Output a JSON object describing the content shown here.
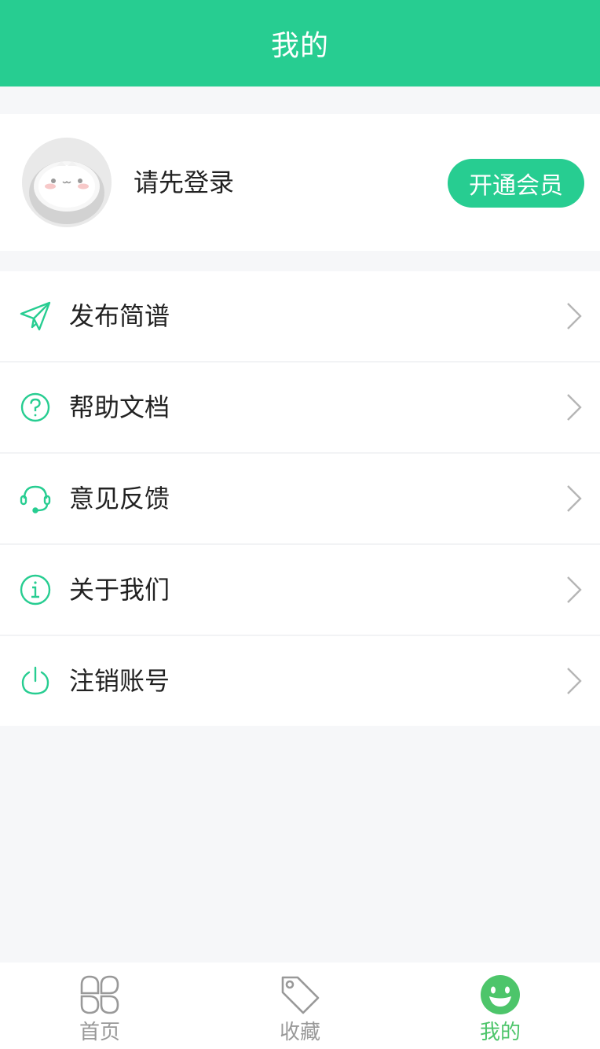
{
  "header": {
    "title": "我的"
  },
  "profile": {
    "login_prompt": "请先登录",
    "vip_button": "开通会员"
  },
  "menu": {
    "items": [
      {
        "label": "发布简谱",
        "icon": "paper-plane-icon"
      },
      {
        "label": "帮助文档",
        "icon": "question-circle-icon"
      },
      {
        "label": "意见反馈",
        "icon": "headset-icon"
      },
      {
        "label": "关于我们",
        "icon": "info-circle-icon"
      },
      {
        "label": "注销账号",
        "icon": "power-icon"
      }
    ]
  },
  "tabbar": {
    "tabs": [
      {
        "label": "首页",
        "icon": "clover-grid-icon",
        "active": false
      },
      {
        "label": "收藏",
        "icon": "tag-icon",
        "active": false
      },
      {
        "label": "我的",
        "icon": "smiley-icon",
        "active": true
      }
    ]
  },
  "colors": {
    "accent": "#27cd91",
    "tab_active": "#4dc56a",
    "tab_inactive": "#999999",
    "background": "#f6f7f9"
  }
}
